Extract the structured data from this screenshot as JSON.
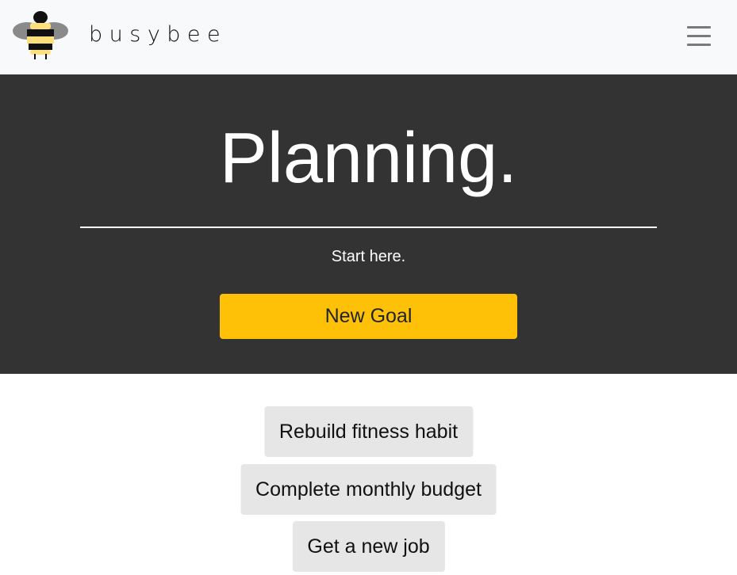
{
  "navbar": {
    "brand": "busybee",
    "logo_icon": "bee-logo-icon",
    "menu_icon": "hamburger-menu-icon"
  },
  "hero": {
    "title": "Planning.",
    "subtitle": "Start here.",
    "new_goal_label": "New Goal"
  },
  "goals": [
    {
      "label": "Rebuild fitness habit"
    },
    {
      "label": "Complete monthly budget"
    },
    {
      "label": "Get a new job"
    }
  ],
  "colors": {
    "navbar_bg": "#f8f9fa",
    "hero_bg": "#333333",
    "accent": "#ffc107",
    "goal_bg": "#e6e6e6"
  }
}
